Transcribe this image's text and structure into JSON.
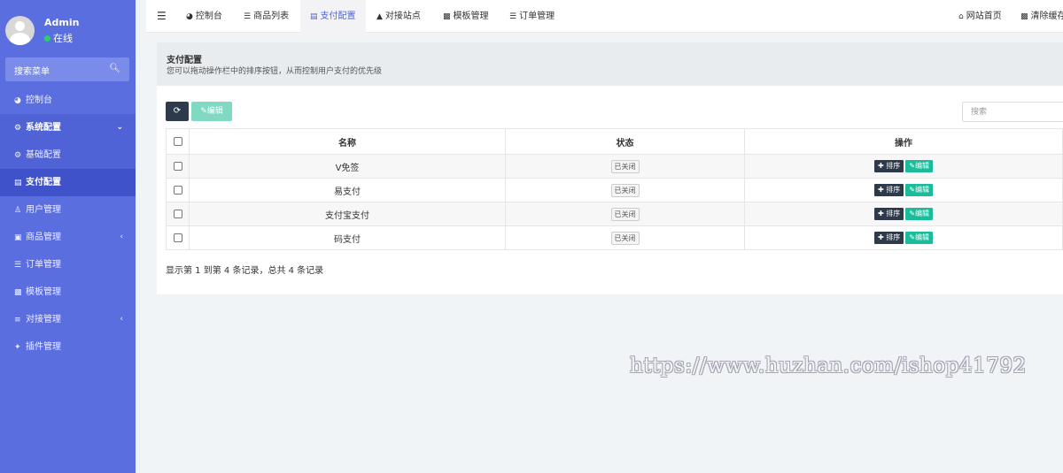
{
  "sidebar": {
    "user": {
      "name": "Admin",
      "status": "在线",
      "status_color": "#2ecc71"
    },
    "search": {
      "placeholder": "搜索菜单",
      "icon": "search-icon"
    },
    "items": [
      {
        "label": "控制台",
        "icon": "dashboard-icon"
      },
      {
        "label": "系统配置",
        "icon": "gear-icon"
      },
      {
        "label": "基础配置",
        "icon": "gear-icon"
      },
      {
        "label": "支付配置",
        "icon": "table-icon"
      },
      {
        "label": "用户管理",
        "icon": "user-icon"
      },
      {
        "label": "商品管理",
        "icon": "cart-icon"
      },
      {
        "label": "订单管理",
        "icon": "list-icon"
      },
      {
        "label": "模板管理",
        "icon": "keyboard-icon"
      },
      {
        "label": "对接管理",
        "icon": "sliders-icon"
      },
      {
        "label": "插件管理",
        "icon": "plug-icon"
      }
    ],
    "colors": {
      "background": "#5a6ee0",
      "active": "#3f52c9"
    }
  },
  "topnav": {
    "menu_icon": "menu-icon",
    "tabs": [
      {
        "label": "控制台",
        "icon": "dashboard-icon"
      },
      {
        "label": "商品列表",
        "icon": "list-icon"
      },
      {
        "label": "支付配置",
        "icon": "table-icon"
      },
      {
        "label": "对接站点",
        "icon": "sitemap-icon"
      },
      {
        "label": "模板管理",
        "icon": "keyboard-icon"
      },
      {
        "label": "订单管理",
        "icon": "list-icon"
      }
    ],
    "right": [
      {
        "label": "网站首页",
        "icon": "home-icon"
      },
      {
        "label": "清除缓存",
        "icon": "trash-icon"
      }
    ]
  },
  "page": {
    "title": "支付配置",
    "description": "您可以拖动操作栏中的排序按钮，从而控制用户支付的优先级"
  },
  "toolbar": {
    "refresh_icon": "refresh-icon",
    "edit_label": "编辑",
    "search_placeholder": "搜索"
  },
  "table": {
    "columns": [
      "名称",
      "状态",
      "操作"
    ],
    "rows": [
      {
        "name": "V免签",
        "status": "已关闭"
      },
      {
        "name": "易支付",
        "status": "已关闭"
      },
      {
        "name": "支付宝支付",
        "status": "已关闭"
      },
      {
        "name": "码支付",
        "status": "已关闭"
      }
    ],
    "actions": {
      "sort": "排序",
      "edit": "编辑"
    }
  },
  "footer": {
    "summary": "显示第 1 到第 4 条记录，总共 4 条记录"
  },
  "watermark": "https://www.huzhan.com/ishop41792"
}
